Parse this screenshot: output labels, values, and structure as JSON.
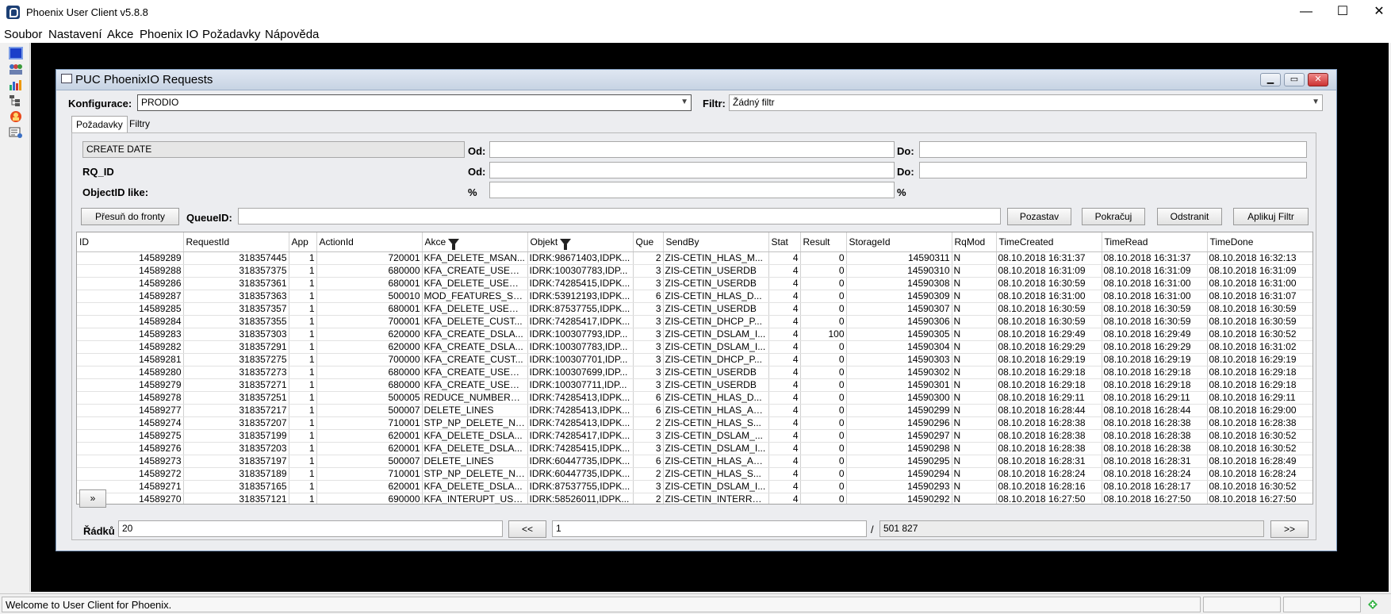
{
  "window": {
    "title": "Phoenix User Client v5.8.8",
    "minimize": "—",
    "maximize": "☐",
    "close": "✕"
  },
  "menu": [
    "Soubor",
    "Nastavení",
    "Akce",
    "Phoenix IO",
    "Požadavky",
    "Nápověda"
  ],
  "toolbar_icons": [
    "monitor-icon",
    "users-icon",
    "chart-icon",
    "tree-icon",
    "alert-person-icon",
    "report-icon"
  ],
  "frame": {
    "title": "PUC PhoenixIO Requests",
    "config_label": "Konfigurace:",
    "config_value": "PRODIO",
    "filter_label": "Filtr:",
    "filter_value": "Žádný filtr",
    "tabs": [
      "Požadavky",
      "Filtry"
    ]
  },
  "criteria": {
    "create_date": "CREATE DATE",
    "from_label": "Od:",
    "to_label": "Do:",
    "rq_id_label": "RQ_ID",
    "objectid_label": "ObjectID like:",
    "percent": "%"
  },
  "queue": {
    "move_button": "Přesuň do fronty",
    "queue_label": "QueueID:",
    "pause_button": "Pozastav",
    "continue_button": "Pokračuj",
    "remove_button": "Odstranit",
    "apply_filter_button": "Aplikuj Filtr"
  },
  "table": {
    "columns": [
      "ID",
      "RequestId",
      "App",
      "ActionId",
      "Akce",
      "Objekt",
      "Que",
      "SendBy",
      "Stat",
      "Result",
      "StorageId",
      "RqMod",
      "TimeCreated",
      "TimeRead",
      "TimeDone"
    ],
    "rows": [
      [
        "14589289",
        "318357445",
        "1",
        "720001",
        "KFA_DELETE_MSAN...",
        "IDRK:98671403,IDPK...",
        "2",
        "ZIS-CETIN_HLAS_M...",
        "4",
        "0",
        "14590311",
        "N",
        "08.10.2018 16:31:37",
        "08.10.2018 16:31:37",
        "08.10.2018 16:32:13"
      ],
      [
        "14589288",
        "318357375",
        "1",
        "680000",
        "KFA_CREATE_USERDB",
        "IDRK:100307783,IDP...",
        "3",
        "ZIS-CETIN_USERDB",
        "4",
        "0",
        "14590310",
        "N",
        "08.10.2018 16:31:09",
        "08.10.2018 16:31:09",
        "08.10.2018 16:31:09"
      ],
      [
        "14589286",
        "318357361",
        "1",
        "680001",
        "KFA_DELETE_USERDB",
        "IDRK:74285415,IDPK...",
        "3",
        "ZIS-CETIN_USERDB",
        "4",
        "0",
        "14590308",
        "N",
        "08.10.2018 16:30:59",
        "08.10.2018 16:31:00",
        "08.10.2018 16:31:00"
      ],
      [
        "14589287",
        "318357363",
        "1",
        "500010",
        "MOD_FEATURES_SU...",
        "IDRK:53912193,IDPK...",
        "6",
        "ZIS-CETIN_HLAS_D...",
        "4",
        "0",
        "14590309",
        "N",
        "08.10.2018 16:31:00",
        "08.10.2018 16:31:00",
        "08.10.2018 16:31:07"
      ],
      [
        "14589285",
        "318357357",
        "1",
        "680001",
        "KFA_DELETE_USERDB",
        "IDRK:87537755,IDPK...",
        "3",
        "ZIS-CETIN_USERDB",
        "4",
        "0",
        "14590307",
        "N",
        "08.10.2018 16:30:59",
        "08.10.2018 16:30:59",
        "08.10.2018 16:30:59"
      ],
      [
        "14589284",
        "318357355",
        "1",
        "700001",
        "KFA_DELETE_CUST...",
        "IDRK:74285417,IDPK...",
        "3",
        "ZIS-CETIN_DHCP_P...",
        "4",
        "0",
        "14590306",
        "N",
        "08.10.2018 16:30:59",
        "08.10.2018 16:30:59",
        "08.10.2018 16:30:59"
      ],
      [
        "14589283",
        "318357303",
        "1",
        "620000",
        "KFA_CREATE_DSLA...",
        "IDRK:100307793,IDP...",
        "3",
        "ZIS-CETIN_DSLAM_I...",
        "4",
        "100",
        "14590305",
        "N",
        "08.10.2018 16:29:49",
        "08.10.2018 16:29:49",
        "08.10.2018 16:30:52"
      ],
      [
        "14589282",
        "318357291",
        "1",
        "620000",
        "KFA_CREATE_DSLA...",
        "IDRK:100307783,IDP...",
        "3",
        "ZIS-CETIN_DSLAM_I...",
        "4",
        "0",
        "14590304",
        "N",
        "08.10.2018 16:29:29",
        "08.10.2018 16:29:29",
        "08.10.2018 16:31:02"
      ],
      [
        "14589281",
        "318357275",
        "1",
        "700000",
        "KFA_CREATE_CUST...",
        "IDRK:100307701,IDP...",
        "3",
        "ZIS-CETIN_DHCP_P...",
        "4",
        "0",
        "14590303",
        "N",
        "08.10.2018 16:29:19",
        "08.10.2018 16:29:19",
        "08.10.2018 16:29:19"
      ],
      [
        "14589280",
        "318357273",
        "1",
        "680000",
        "KFA_CREATE_USERDB",
        "IDRK:100307699,IDP...",
        "3",
        "ZIS-CETIN_USERDB",
        "4",
        "0",
        "14590302",
        "N",
        "08.10.2018 16:29:18",
        "08.10.2018 16:29:18",
        "08.10.2018 16:29:18"
      ],
      [
        "14589279",
        "318357271",
        "1",
        "680000",
        "KFA_CREATE_USERDB",
        "IDRK:100307711,IDP...",
        "3",
        "ZIS-CETIN_USERDB",
        "4",
        "0",
        "14590301",
        "N",
        "08.10.2018 16:29:18",
        "08.10.2018 16:29:18",
        "08.10.2018 16:29:18"
      ],
      [
        "14589278",
        "318357251",
        "1",
        "500005",
        "REDUCE_NUMBER_P...",
        "IDRK:74285413,IDPK...",
        "6",
        "ZIS-CETIN_HLAS_D...",
        "4",
        "0",
        "14590300",
        "N",
        "08.10.2018 16:29:11",
        "08.10.2018 16:29:11",
        "08.10.2018 16:29:11"
      ],
      [
        "14589277",
        "318357217",
        "1",
        "500007",
        "DELETE_LINES",
        "IDRK:74285413,IDPK...",
        "6",
        "ZIS-CETIN_HLAS_AK...",
        "4",
        "0",
        "14590299",
        "N",
        "08.10.2018 16:28:44",
        "08.10.2018 16:28:44",
        "08.10.2018 16:29:00"
      ],
      [
        "14589274",
        "318357207",
        "1",
        "710001",
        "STP_NP_DELETE_NU...",
        "IDRK:74285413,IDPK...",
        "2",
        "ZIS-CETIN_HLAS_S...",
        "4",
        "0",
        "14590296",
        "N",
        "08.10.2018 16:28:38",
        "08.10.2018 16:28:38",
        "08.10.2018 16:28:38"
      ],
      [
        "14589275",
        "318357199",
        "1",
        "620001",
        "KFA_DELETE_DSLA...",
        "IDRK:74285417,IDPK...",
        "3",
        "ZIS-CETIN_DSLAM_...",
        "4",
        "0",
        "14590297",
        "N",
        "08.10.2018 16:28:38",
        "08.10.2018 16:28:38",
        "08.10.2018 16:30:52"
      ],
      [
        "14589276",
        "318357203",
        "1",
        "620001",
        "KFA_DELETE_DSLA...",
        "IDRK:74285415,IDPK...",
        "3",
        "ZIS-CETIN_DSLAM_I...",
        "4",
        "0",
        "14590298",
        "N",
        "08.10.2018 16:28:38",
        "08.10.2018 16:28:38",
        "08.10.2018 16:30:52"
      ],
      [
        "14589273",
        "318357197",
        "1",
        "500007",
        "DELETE_LINES",
        "IDRK:60447735,IDPK...",
        "6",
        "ZIS-CETIN_HLAS_AK...",
        "4",
        "0",
        "14590295",
        "N",
        "08.10.2018 16:28:31",
        "08.10.2018 16:28:31",
        "08.10.2018 16:28:49"
      ],
      [
        "14589272",
        "318357189",
        "1",
        "710001",
        "STP_NP_DELETE_NU...",
        "IDRK:60447735,IDPK...",
        "2",
        "ZIS-CETIN_HLAS_S...",
        "4",
        "0",
        "14590294",
        "N",
        "08.10.2018 16:28:24",
        "08.10.2018 16:28:24",
        "08.10.2018 16:28:24"
      ],
      [
        "14589271",
        "318357165",
        "1",
        "620001",
        "KFA_DELETE_DSLA...",
        "IDRK:87537755,IDPK...",
        "3",
        "ZIS-CETIN_DSLAM_I...",
        "4",
        "0",
        "14590293",
        "N",
        "08.10.2018 16:28:16",
        "08.10.2018 16:28:17",
        "08.10.2018 16:30:52"
      ],
      [
        "14589270",
        "318357121",
        "1",
        "690000",
        "KFA_INTERUPT_USER",
        "IDRK:58526011,IDPK...",
        "2",
        "ZIS-CETIN_INTERRU...",
        "4",
        "0",
        "14590292",
        "N",
        "08.10.2018 16:27:50",
        "08.10.2018 16:27:50",
        "08.10.2018 16:27:50"
      ]
    ]
  },
  "expand_button": "»",
  "pager": {
    "rows_label": "Řádků",
    "rows_value": "20",
    "prev_button": "<<",
    "page_value": "1",
    "separator": "/",
    "total_value": "501 827",
    "next_button": ">>"
  },
  "status": {
    "text": "Welcome to User Client for Phoenix."
  }
}
